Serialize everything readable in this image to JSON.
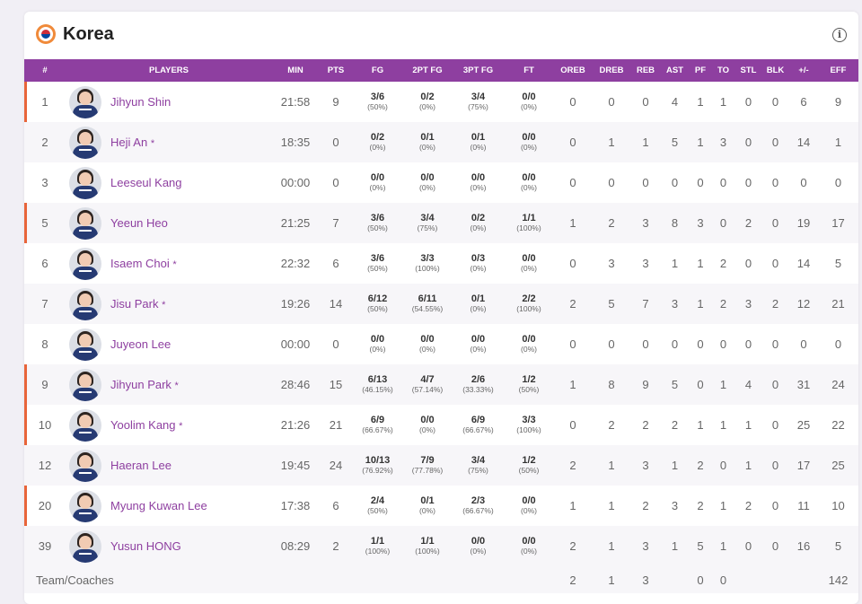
{
  "team": {
    "name": "Korea"
  },
  "columns": [
    "#",
    "PLAYERS",
    "MIN",
    "PTS",
    "FG",
    "2PT FG",
    "3PT FG",
    "FT",
    "OREB",
    "DREB",
    "REB",
    "AST",
    "PF",
    "TO",
    "STL",
    "BLK",
    "+/-",
    "EFF"
  ],
  "players": [
    {
      "num": "1",
      "name": "Jihyun Shin",
      "star": "",
      "starter": true,
      "min": "21:58",
      "pts": "9",
      "fg": "3/6",
      "fgp": "(50%)",
      "p2": "0/2",
      "p2p": "(0%)",
      "p3": "3/4",
      "p3p": "(75%)",
      "ft": "0/0",
      "ftp": "(0%)",
      "oreb": "0",
      "dreb": "0",
      "reb": "0",
      "ast": "4",
      "pf": "1",
      "to": "1",
      "stl": "0",
      "blk": "0",
      "pm": "6",
      "eff": "9"
    },
    {
      "num": "2",
      "name": "Heji An",
      "star": "*",
      "starter": false,
      "min": "18:35",
      "pts": "0",
      "fg": "0/2",
      "fgp": "(0%)",
      "p2": "0/1",
      "p2p": "(0%)",
      "p3": "0/1",
      "p3p": "(0%)",
      "ft": "0/0",
      "ftp": "(0%)",
      "oreb": "0",
      "dreb": "1",
      "reb": "1",
      "ast": "5",
      "pf": "1",
      "to": "3",
      "stl": "0",
      "blk": "0",
      "pm": "14",
      "eff": "1"
    },
    {
      "num": "3",
      "name": "Leeseul Kang",
      "star": "",
      "starter": false,
      "min": "00:00",
      "pts": "0",
      "fg": "0/0",
      "fgp": "(0%)",
      "p2": "0/0",
      "p2p": "(0%)",
      "p3": "0/0",
      "p3p": "(0%)",
      "ft": "0/0",
      "ftp": "(0%)",
      "oreb": "0",
      "dreb": "0",
      "reb": "0",
      "ast": "0",
      "pf": "0",
      "to": "0",
      "stl": "0",
      "blk": "0",
      "pm": "0",
      "eff": "0"
    },
    {
      "num": "5",
      "name": "Yeeun Heo",
      "star": "",
      "starter": true,
      "min": "21:25",
      "pts": "7",
      "fg": "3/6",
      "fgp": "(50%)",
      "p2": "3/4",
      "p2p": "(75%)",
      "p3": "0/2",
      "p3p": "(0%)",
      "ft": "1/1",
      "ftp": "(100%)",
      "oreb": "1",
      "dreb": "2",
      "reb": "3",
      "ast": "8",
      "pf": "3",
      "to": "0",
      "stl": "2",
      "blk": "0",
      "pm": "19",
      "eff": "17"
    },
    {
      "num": "6",
      "name": "Isaem Choi",
      "star": "*",
      "starter": false,
      "min": "22:32",
      "pts": "6",
      "fg": "3/6",
      "fgp": "(50%)",
      "p2": "3/3",
      "p2p": "(100%)",
      "p3": "0/3",
      "p3p": "(0%)",
      "ft": "0/0",
      "ftp": "(0%)",
      "oreb": "0",
      "dreb": "3",
      "reb": "3",
      "ast": "1",
      "pf": "1",
      "to": "2",
      "stl": "0",
      "blk": "0",
      "pm": "14",
      "eff": "5"
    },
    {
      "num": "7",
      "name": "Jisu Park",
      "star": "*",
      "starter": false,
      "min": "19:26",
      "pts": "14",
      "fg": "6/12",
      "fgp": "(50%)",
      "p2": "6/11",
      "p2p": "(54.55%)",
      "p3": "0/1",
      "p3p": "(0%)",
      "ft": "2/2",
      "ftp": "(100%)",
      "oreb": "2",
      "dreb": "5",
      "reb": "7",
      "ast": "3",
      "pf": "1",
      "to": "2",
      "stl": "3",
      "blk": "2",
      "pm": "12",
      "eff": "21"
    },
    {
      "num": "8",
      "name": "Juyeon Lee",
      "star": "",
      "starter": false,
      "min": "00:00",
      "pts": "0",
      "fg": "0/0",
      "fgp": "(0%)",
      "p2": "0/0",
      "p2p": "(0%)",
      "p3": "0/0",
      "p3p": "(0%)",
      "ft": "0/0",
      "ftp": "(0%)",
      "oreb": "0",
      "dreb": "0",
      "reb": "0",
      "ast": "0",
      "pf": "0",
      "to": "0",
      "stl": "0",
      "blk": "0",
      "pm": "0",
      "eff": "0"
    },
    {
      "num": "9",
      "name": "Jihyun Park",
      "star": "*",
      "starter": true,
      "min": "28:46",
      "pts": "15",
      "fg": "6/13",
      "fgp": "(46.15%)",
      "p2": "4/7",
      "p2p": "(57.14%)",
      "p3": "2/6",
      "p3p": "(33.33%)",
      "ft": "1/2",
      "ftp": "(50%)",
      "oreb": "1",
      "dreb": "8",
      "reb": "9",
      "ast": "5",
      "pf": "0",
      "to": "1",
      "stl": "4",
      "blk": "0",
      "pm": "31",
      "eff": "24"
    },
    {
      "num": "10",
      "name": "Yoolim Kang",
      "star": "*",
      "starter": true,
      "min": "21:26",
      "pts": "21",
      "fg": "6/9",
      "fgp": "(66.67%)",
      "p2": "0/0",
      "p2p": "(0%)",
      "p3": "6/9",
      "p3p": "(66.67%)",
      "ft": "3/3",
      "ftp": "(100%)",
      "oreb": "0",
      "dreb": "2",
      "reb": "2",
      "ast": "2",
      "pf": "1",
      "to": "1",
      "stl": "1",
      "blk": "0",
      "pm": "25",
      "eff": "22"
    },
    {
      "num": "12",
      "name": "Haeran Lee",
      "star": "",
      "starter": false,
      "min": "19:45",
      "pts": "24",
      "fg": "10/13",
      "fgp": "(76.92%)",
      "p2": "7/9",
      "p2p": "(77.78%)",
      "p3": "3/4",
      "p3p": "(75%)",
      "ft": "1/2",
      "ftp": "(50%)",
      "oreb": "2",
      "dreb": "1",
      "reb": "3",
      "ast": "1",
      "pf": "2",
      "to": "0",
      "stl": "1",
      "blk": "0",
      "pm": "17",
      "eff": "25"
    },
    {
      "num": "20",
      "name": "Myung Kuwan Lee",
      "star": "",
      "starter": true,
      "min": "17:38",
      "pts": "6",
      "fg": "2/4",
      "fgp": "(50%)",
      "p2": "0/1",
      "p2p": "(0%)",
      "p3": "2/3",
      "p3p": "(66.67%)",
      "ft": "0/0",
      "ftp": "(0%)",
      "oreb": "1",
      "dreb": "1",
      "reb": "2",
      "ast": "3",
      "pf": "2",
      "to": "1",
      "stl": "2",
      "blk": "0",
      "pm": "11",
      "eff": "10"
    },
    {
      "num": "39",
      "name": "Yusun HONG",
      "star": "",
      "starter": false,
      "min": "08:29",
      "pts": "2",
      "fg": "1/1",
      "fgp": "(100%)",
      "p2": "1/1",
      "p2p": "(100%)",
      "p3": "0/0",
      "p3p": "(0%)",
      "ft": "0/0",
      "ftp": "(0%)",
      "oreb": "2",
      "dreb": "1",
      "reb": "3",
      "ast": "1",
      "pf": "5",
      "to": "1",
      "stl": "0",
      "blk": "0",
      "pm": "16",
      "eff": "5"
    }
  ],
  "team_row": {
    "label": "Team/Coaches",
    "oreb": "2",
    "dreb": "1",
    "reb": "3",
    "pf": "0",
    "to": "0",
    "eff": "142"
  },
  "colors": {
    "header_bg": "#8e3fa0",
    "player_link": "#8e3fa0",
    "starter_marker": "#e8643a",
    "flag_ring": "#f08a3a"
  },
  "icons": {
    "team_logo": "korea-flag-icon",
    "info": "info-icon",
    "avatar": "player-avatar"
  }
}
